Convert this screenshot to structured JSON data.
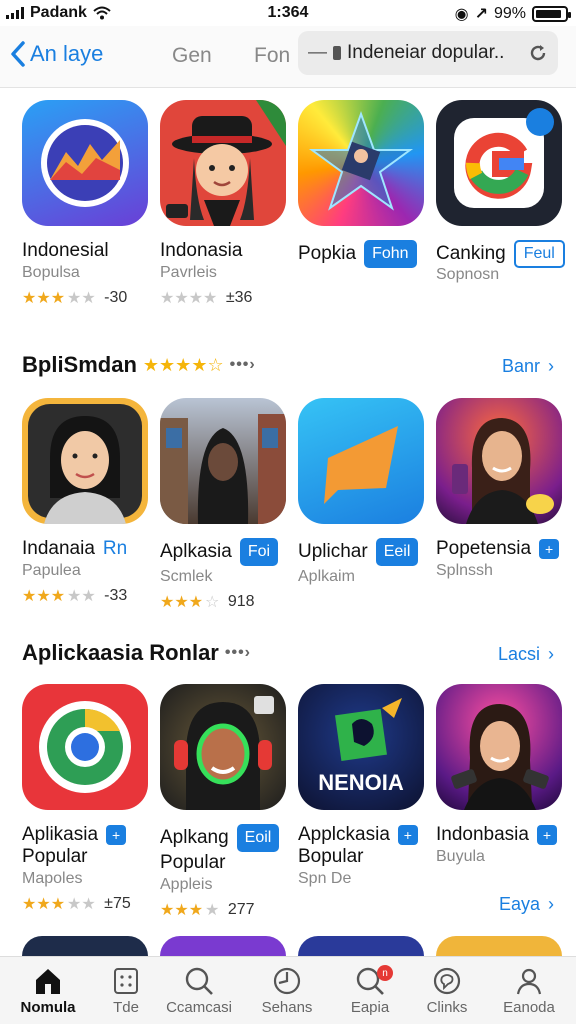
{
  "status": {
    "carrier": "Padank",
    "time": "1:364",
    "battery": "99%"
  },
  "nav": {
    "back_label": "An laye",
    "tab1": "Gen",
    "tab2": "Fon",
    "search_value": "Indeneiar dopular.."
  },
  "row1": {
    "apps": [
      {
        "name": "Indonesial",
        "sub": "Bopulsa",
        "rating": 3,
        "count": "-30"
      },
      {
        "name": "Indonasia",
        "sub": "Pavrleis",
        "rating": 0,
        "count": "±36"
      },
      {
        "name": "Popkia",
        "button": "Fohn"
      },
      {
        "name": "Canking",
        "sub": "Sopnosn",
        "button": "Feul"
      }
    ]
  },
  "section2": {
    "title": "BpliSmdan",
    "link": "Banr",
    "apps": [
      {
        "name": "Indanaia",
        "tag": "Rn",
        "sub": "Papulea",
        "rating": 3,
        "count": "-33"
      },
      {
        "name": "Aplkasia",
        "button": "Foi",
        "sub": "Scmlek",
        "rating": 2.5,
        "count": "918"
      },
      {
        "name": "Uplichar",
        "button": "Eeil",
        "sub": "Aplkaim"
      },
      {
        "name": "Popetensia",
        "plus": "+",
        "sub": "Splnssh"
      }
    ]
  },
  "section3": {
    "title": "Aplickaasia Ronlar",
    "link": "Lacsi",
    "apps": [
      {
        "name": "Aplikasia",
        "name2": "Popular",
        "plus": "+",
        "sub": "Mapoles",
        "rating": 3,
        "count": "±75"
      },
      {
        "name": "Aplkang",
        "name2": "Popular",
        "button": "Eoil",
        "sub": "Appleis",
        "rating": 3,
        "count": "277"
      },
      {
        "name": "Applckasia",
        "name2": "Bopular",
        "plus": "+",
        "sub": "Spn De"
      },
      {
        "name": "Indonbasia",
        "plus": "+",
        "sub": "Buyula"
      }
    ],
    "brand_text": "NENOIA",
    "more_link": "Eaya"
  },
  "tabs": [
    {
      "label": "Nomula",
      "icon": "home-icon",
      "active": true
    },
    {
      "label": "Tde",
      "icon": "grid-icon"
    },
    {
      "label": "Ccamcasi",
      "icon": "search-icon"
    },
    {
      "label": "Sehans",
      "icon": "clock-icon"
    },
    {
      "label": "Eapia",
      "icon": "search-badge-icon",
      "badge": "n"
    },
    {
      "label": "Clinks",
      "icon": "chat-icon"
    },
    {
      "label": "Eanoda",
      "icon": "person-icon"
    }
  ],
  "colors": {
    "accent": "#1a7fe0",
    "star": "#f0a81c"
  }
}
